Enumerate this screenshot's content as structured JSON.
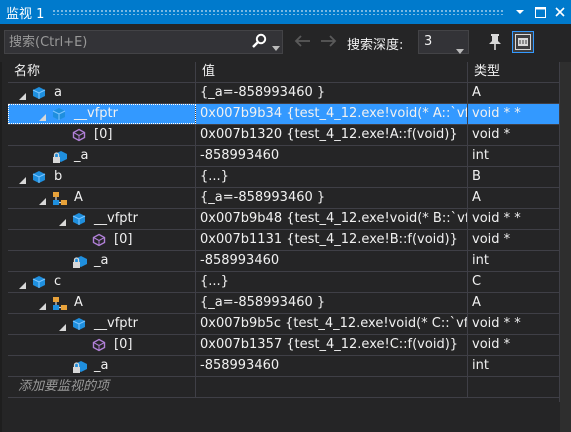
{
  "window": {
    "title": "监视 1"
  },
  "toolbar": {
    "search_placeholder": "搜索(Ctrl+E)",
    "depth_label": "搜索深度:",
    "depth_value": "3"
  },
  "columns": {
    "name": "名称",
    "value": "值",
    "type": "类型"
  },
  "rows": [
    {
      "name": "a",
      "value": "{_a=-858993460 }",
      "type": "A",
      "level": 0,
      "icon": "object-icon",
      "expander": "expanded"
    },
    {
      "name": "__vfptr",
      "value": "0x007b9b34 {test_4_12.exe!void(* A::`vf…",
      "type": "void * *",
      "level": 1,
      "icon": "object-icon",
      "expander": "expanded",
      "selected": true
    },
    {
      "name": "[0]",
      "value": "0x007b1320 {test_4_12.exe!A::f(void)}",
      "type": "void *",
      "level": 2,
      "icon": "method-icon",
      "expander": "none"
    },
    {
      "name": "_a",
      "value": "-858993460",
      "type": "int",
      "level": 1,
      "icon": "private-field-icon",
      "expander": "none"
    },
    {
      "name": "b",
      "value": "{...}",
      "type": "B",
      "level": 0,
      "icon": "object-icon",
      "expander": "expanded"
    },
    {
      "name": "A",
      "value": "{_a=-858993460 }",
      "type": "A",
      "level": 1,
      "icon": "base-class-icon",
      "expander": "expanded"
    },
    {
      "name": "__vfptr",
      "value": "0x007b9b48 {test_4_12.exe!void(* B::`vf…",
      "type": "void * *",
      "level": 2,
      "icon": "object-icon",
      "expander": "expanded"
    },
    {
      "name": "[0]",
      "value": "0x007b1131 {test_4_12.exe!B::f(void)}",
      "type": "void *",
      "level": 3,
      "icon": "method-icon",
      "expander": "none"
    },
    {
      "name": "_a",
      "value": "-858993460",
      "type": "int",
      "level": 2,
      "icon": "private-field-icon",
      "expander": "none"
    },
    {
      "name": "c",
      "value": "{...}",
      "type": "C",
      "level": 0,
      "icon": "object-icon",
      "expander": "expanded"
    },
    {
      "name": "A",
      "value": "{_a=-858993460 }",
      "type": "A",
      "level": 1,
      "icon": "base-class-icon",
      "expander": "expanded"
    },
    {
      "name": "__vfptr",
      "value": "0x007b9b5c {test_4_12.exe!void(* C::`vf…",
      "type": "void * *",
      "level": 2,
      "icon": "object-icon",
      "expander": "expanded"
    },
    {
      "name": "[0]",
      "value": "0x007b1357 {test_4_12.exe!C::f(void)}",
      "type": "void *",
      "level": 3,
      "icon": "method-icon",
      "expander": "none"
    },
    {
      "name": "_a",
      "value": "-858993460",
      "type": "int",
      "level": 2,
      "icon": "private-field-icon",
      "expander": "none"
    }
  ],
  "add_row": {
    "placeholder": "添加要监视的项"
  },
  "colors": {
    "accent": "#007acc",
    "selection": "#3399ff",
    "background": "#252526",
    "grid_line": "#3f3f46"
  }
}
